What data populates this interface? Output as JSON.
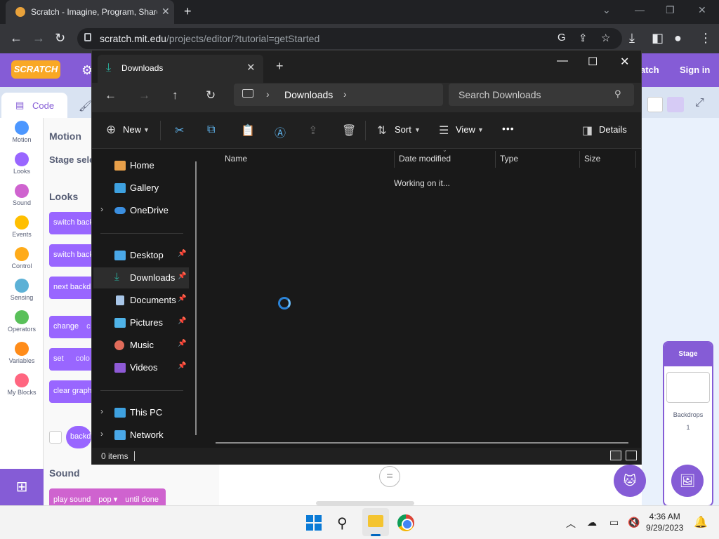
{
  "browser": {
    "tab_title": "Scratch - Imagine, Program, Share",
    "tab_close": "✕",
    "new_tab": "+",
    "url_host": "scratch.mit.edu",
    "url_path": "/projects/editor/?tutorial=getStarted",
    "win_min": "⌄",
    "win_min2": "—",
    "win_restore": "❐",
    "win_close": "✕"
  },
  "scratch": {
    "logo": "SCRATCH",
    "header_links": [
      "atch",
      "Sign in"
    ],
    "code_tab": "Code",
    "categories": [
      {
        "label": "Motion",
        "color": "#4c97ff"
      },
      {
        "label": "Looks",
        "color": "#9966ff"
      },
      {
        "label": "Sound",
        "color": "#cf63cf"
      },
      {
        "label": "Events",
        "color": "#ffbf00"
      },
      {
        "label": "Control",
        "color": "#ffab19"
      },
      {
        "label": "Sensing",
        "color": "#5cb1d6"
      },
      {
        "label": "Operators",
        "color": "#59c059"
      },
      {
        "label": "Variables",
        "color": "#ff8c1a"
      },
      {
        "label": "My Blocks",
        "color": "#ff6680"
      }
    ],
    "palette": {
      "motion_heading": "Motion",
      "stage_selected": "Stage sele",
      "looks_heading": "Looks",
      "blocks": [
        "switch back",
        "switch back",
        "next backdr",
        "change",
        "set",
        "clear graph",
        "backd"
      ],
      "change_extra": "c",
      "set_extra": "colo",
      "sound_heading": "Sound",
      "play_sound": "play sound",
      "pop": "pop ▾",
      "until_done": "until done"
    },
    "stage_panel": {
      "title": "Stage",
      "backdrops_label": "Backdrops",
      "backdrops_count": "1"
    },
    "zoom_reset": "="
  },
  "explorer": {
    "tab_title": "Downloads",
    "tab_close": "✕",
    "new_tab": "+",
    "win_min": "—",
    "win_max": "☐",
    "win_close": "✕",
    "address_location": "Downloads",
    "search_placeholder": "Search Downloads",
    "commands": {
      "new": "New",
      "sort": "Sort",
      "view": "View",
      "more": "•••",
      "details": "Details"
    },
    "nav_items": [
      {
        "label": "Home",
        "color": "#e8a04a"
      },
      {
        "label": "Gallery",
        "color": "#3ea1e0"
      },
      {
        "label": "OneDrive",
        "color": "#3b8fe0"
      },
      {
        "label": "Desktop",
        "color": "#4aa8e8"
      },
      {
        "label": "Downloads",
        "color": "#2bb5a2"
      },
      {
        "label": "Documents",
        "color": "#a8c6e8"
      },
      {
        "label": "Pictures",
        "color": "#4fb3e8"
      },
      {
        "label": "Music",
        "color": "#e06b5a"
      },
      {
        "label": "Videos",
        "color": "#8e5ad6"
      },
      {
        "label": "This PC",
        "color": "#3ea1e0"
      },
      {
        "label": "Network",
        "color": "#4aa8e8"
      }
    ],
    "columns": [
      "Name",
      "Date modified",
      "Type",
      "Size"
    ],
    "working_text": "Working on it...",
    "status_count": "0 items"
  },
  "taskbar": {
    "time": "4:36 AM",
    "date": "9/29/2023"
  }
}
